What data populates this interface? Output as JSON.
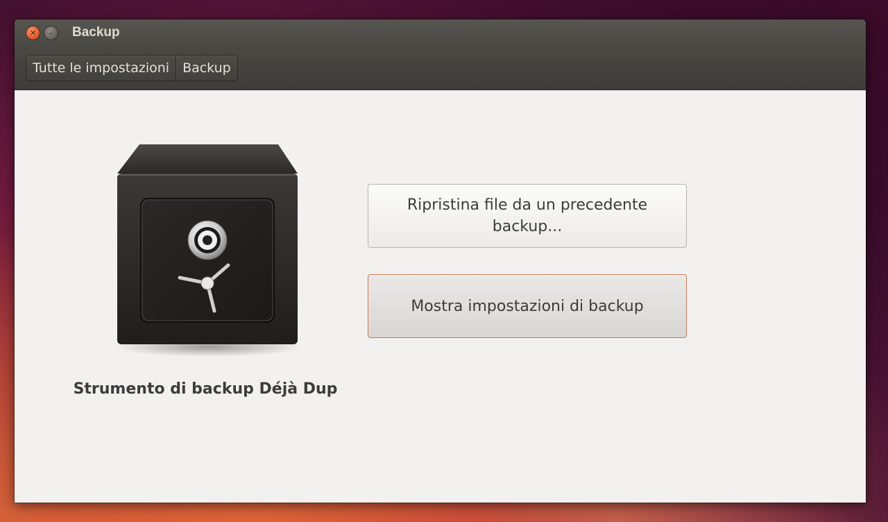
{
  "window": {
    "title": "Backup",
    "close_icon": "close-icon",
    "minimize_icon": "minimize-icon"
  },
  "breadcrumb": {
    "items": [
      {
        "label": "Tutte le impostazioni"
      },
      {
        "label": "Backup"
      }
    ]
  },
  "main": {
    "app_icon": "safe-icon",
    "app_name": "Strumento di backup Déjà Dup",
    "restore_button_label": "Ripristina file da un precedente backup...",
    "settings_button_label": "Mostra impostazioni di backup"
  },
  "colors": {
    "accent": "#e6602d",
    "focus_border": "#c87a58",
    "titlebar": "#4a4843",
    "content_bg": "#f2f1f0"
  }
}
